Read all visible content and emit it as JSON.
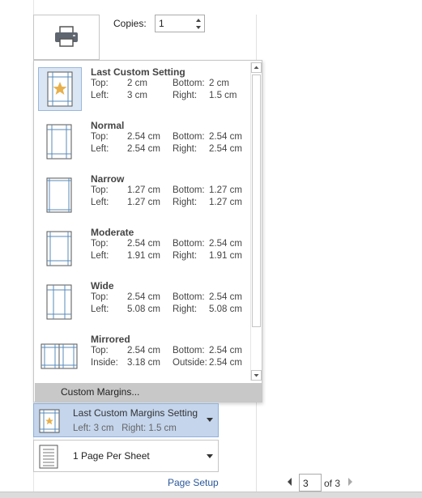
{
  "print": {
    "icon": "printer-icon"
  },
  "copies": {
    "label": "Copies:",
    "value": "1"
  },
  "margins_menu": {
    "options": [
      {
        "title": "Last Custom Setting",
        "k1": "Top:",
        "v1": "2 cm",
        "k2": "Bottom:",
        "v2": "2 cm",
        "k3": "Left:",
        "v3": "3 cm",
        "k4": "Right:",
        "v4": "1.5 cm",
        "selected": true
      },
      {
        "title": "Normal",
        "k1": "Top:",
        "v1": "2.54 cm",
        "k2": "Bottom:",
        "v2": "2.54 cm",
        "k3": "Left:",
        "v3": "2.54 cm",
        "k4": "Right:",
        "v4": "2.54 cm"
      },
      {
        "title": "Narrow",
        "k1": "Top:",
        "v1": "1.27 cm",
        "k2": "Bottom:",
        "v2": "1.27 cm",
        "k3": "Left:",
        "v3": "1.27 cm",
        "k4": "Right:",
        "v4": "1.27 cm"
      },
      {
        "title": "Moderate",
        "k1": "Top:",
        "v1": "2.54 cm",
        "k2": "Bottom:",
        "v2": "2.54 cm",
        "k3": "Left:",
        "v3": "1.91 cm",
        "k4": "Right:",
        "v4": "1.91 cm"
      },
      {
        "title": "Wide",
        "k1": "Top:",
        "v1": "2.54 cm",
        "k2": "Bottom:",
        "v2": "2.54 cm",
        "k3": "Left:",
        "v3": "5.08 cm",
        "k4": "Right:",
        "v4": "5.08 cm"
      },
      {
        "title": "Mirrored",
        "k1": "Top:",
        "v1": "2.54 cm",
        "k2": "Bottom:",
        "v2": "2.54 cm",
        "k3": "Inside:",
        "v3": "3.18 cm",
        "k4": "Outside:",
        "v4": "2.54 cm"
      }
    ],
    "custom_margins_label": "Custom Margins..."
  },
  "margins_dropdown": {
    "title": "Last Custom Margins Setting",
    "left_label": "Left:",
    "left_value": "3 cm",
    "right_label": "Right:",
    "right_value": "1.5 cm"
  },
  "pages_per_sheet": {
    "label": "1 Page Per Sheet"
  },
  "page_setup_link": "Page Setup",
  "page_nav": {
    "current": "3",
    "of_label": "of 3"
  },
  "colors": {
    "accent": "#2b579a",
    "selection_bg": "#c4d5ec",
    "selection_border": "#8fb0db",
    "star": "#e7b04b",
    "margin_line": "#5a8bb8"
  }
}
